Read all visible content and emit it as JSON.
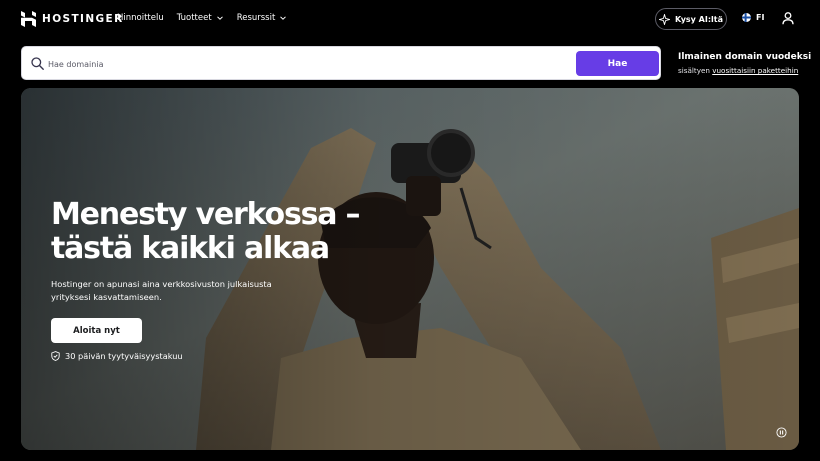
{
  "nav": {
    "brand": "HOSTINGER",
    "links": [
      {
        "label": "Hinnoittelu",
        "dropdown": false
      },
      {
        "label": "Tuotteet",
        "dropdown": true
      },
      {
        "label": "Resurssit",
        "dropdown": true
      }
    ],
    "ai_button": "Kysy AI:ltä",
    "language": "FI",
    "icons": {
      "logo": "hostinger-logo-icon",
      "ai": "sparkle-icon",
      "flag": "finland-flag-icon",
      "user": "user-icon",
      "chevron": "chevron-down-icon"
    }
  },
  "search": {
    "placeholder": "Hae domainia",
    "value": "",
    "button_label": "Hae",
    "icon": "search-icon"
  },
  "promo": {
    "title": "Ilmainen domain vuodeksi",
    "prefix": "sisältyen ",
    "link_text": "vuosittaisiin paketteihin"
  },
  "hero": {
    "title_line1": "Menesty verkossa –",
    "title_line2": "tästä kaikki alkaa",
    "description": "Hostinger on apunasi aina verkkosivuston julkaisusta yrityksesi kasvattamiseen.",
    "cta_label": "Aloita nyt",
    "guarantee_text": "30 päivän tyytyväisyystakuu",
    "icons": {
      "guarantee": "shield-check-icon",
      "media": "pause-icon"
    }
  },
  "colors": {
    "accent": "#673de6",
    "background": "#000000",
    "text": "#ffffff"
  }
}
